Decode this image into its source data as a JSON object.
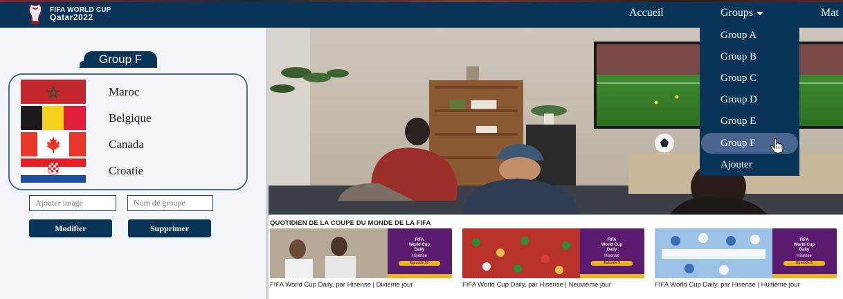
{
  "brand": {
    "line1": "FIFA WORLD CUP",
    "line2": "Qatar2022"
  },
  "nav": {
    "home": "Accueil",
    "groups": "Groups",
    "matches": "Mat"
  },
  "dropdown": {
    "items": [
      "Group A",
      "Group B",
      "Group C",
      "Group D",
      "Group E",
      "Group F",
      "Ajouter"
    ],
    "active_index": 5
  },
  "group": {
    "title": "Group F",
    "teams": [
      "Maroc",
      "Belgique",
      "Canada",
      "Croatie"
    ]
  },
  "form": {
    "image_placeholder": "Ajouter image",
    "name_placeholder": "Nom de groupe",
    "modify_label": "Modifier",
    "delete_label": "Supprimer"
  },
  "daily": {
    "title": "QUOTIDIEN DE LA COUPE DU MONDE DE LA FIFA",
    "videos": [
      {
        "title": "FIFA World Cup Daily, par Hisense | Dixième jour",
        "episode": "Episode 10"
      },
      {
        "title": "FIFA World Cup Daily, par Hisense | Neuvième jour",
        "episode": "Episode 9"
      },
      {
        "title": "FIFA World Cup Daily, par Hisense | Huitième jour",
        "episode": "Episode 8"
      }
    ],
    "badge": {
      "line1": "FIFA",
      "line2": "World Cup",
      "line3": "Daily",
      "sponsor": "Hisense"
    }
  },
  "colors": {
    "navy": "#0b3558",
    "active": "#4a6590",
    "purple": "#5b1b6e",
    "gold": "#e8b423"
  }
}
